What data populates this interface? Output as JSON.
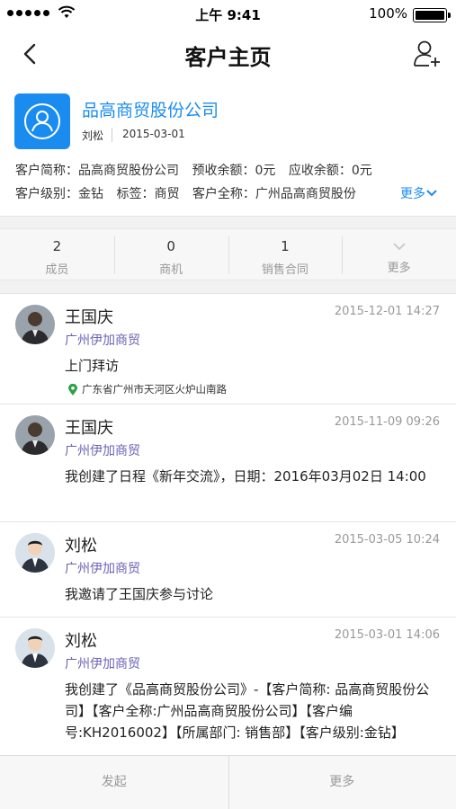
{
  "status_bar": {
    "time": "上午 9:41",
    "battery": "100%"
  },
  "nav": {
    "title": "客户主页"
  },
  "customer": {
    "name": "品高商贸股份公司",
    "owner": "刘松",
    "created": "2015-03-01",
    "short_name": "客户简称：品高商贸股份公司",
    "prepaid": "预收余额：0元",
    "receivable": "应收余额：0元",
    "level": "客户级别：金钻",
    "tag": "标签：商贸",
    "full_name": "客户全称：广州品高商贸股份",
    "more_label": "更多"
  },
  "stats": [
    {
      "value": "2",
      "label": "成员"
    },
    {
      "value": "0",
      "label": "商机"
    },
    {
      "value": "1",
      "label": "销售合同"
    },
    {
      "label": "更多"
    }
  ],
  "feed": [
    {
      "author": "王国庆",
      "time": "2015-12-01 14:27",
      "company": "广州伊加商贸",
      "content": "上门拜访",
      "location": "广东省广州市天河区火炉山南路"
    },
    {
      "author": "王国庆",
      "time": "2015-11-09 09:26",
      "company": "广州伊加商贸",
      "content": "我创建了日程《新年交流》，日期：2016年03月02日 14:00"
    },
    {
      "author": "刘松",
      "time": "2015-03-05 10:24",
      "company": "广州伊加商贸",
      "content": "我邀请了王国庆参与讨论"
    },
    {
      "author": "刘松",
      "time": "2015-03-01 14:06",
      "company": "广州伊加商贸",
      "content": "我创建了《品高商贸股份公司》-【客户简称: 品高商贸股份公司】【客户全称:广州品高商贸股份公司】【客户编号:KH2016002】【所属部门: 销售部】【客户级别:金钻】"
    }
  ],
  "bottom": {
    "start": "发起",
    "more": "更多"
  },
  "colors": {
    "accent": "#1a8cf0",
    "company": "#6b63b5"
  }
}
